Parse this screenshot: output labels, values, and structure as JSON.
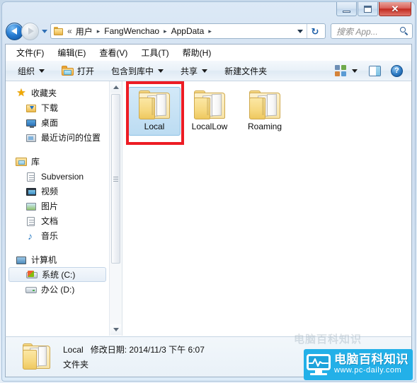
{
  "window": {
    "controls": {
      "minimize": "–",
      "maximize": "□",
      "close": "✕"
    }
  },
  "address": {
    "back_tooltip": "后退",
    "forward_tooltip": "前进",
    "chevron": "«",
    "crumbs": [
      "用户",
      "FangWenchao",
      "AppData"
    ],
    "separator": "▸",
    "refresh_glyph": "↻"
  },
  "search": {
    "placeholder": "搜索 App..."
  },
  "menu": {
    "items": [
      {
        "label": "文件(F)"
      },
      {
        "label": "编辑(E)"
      },
      {
        "label": "查看(V)"
      },
      {
        "label": "工具(T)"
      },
      {
        "label": "帮助(H)"
      }
    ]
  },
  "toolbar": {
    "organize": "组织",
    "open": "打开",
    "include_in_library": "包含到库中",
    "share": "共享",
    "new_folder": "新建文件夹",
    "help_glyph": "?"
  },
  "sidebar": {
    "groups": [
      {
        "header": {
          "label": "收藏夹",
          "icon": "star-icon"
        },
        "items": [
          {
            "label": "下载",
            "icon": "downloads-icon"
          },
          {
            "label": "桌面",
            "icon": "desktop-icon"
          },
          {
            "label": "最近访问的位置",
            "icon": "recent-places-icon"
          }
        ]
      },
      {
        "header": {
          "label": "库",
          "icon": "library-icon"
        },
        "items": [
          {
            "label": "Subversion",
            "icon": "subversion-icon"
          },
          {
            "label": "视频",
            "icon": "video-icon"
          },
          {
            "label": "图片",
            "icon": "pictures-icon"
          },
          {
            "label": "文档",
            "icon": "documents-icon"
          },
          {
            "label": "音乐",
            "icon": "music-icon"
          }
        ]
      },
      {
        "header": {
          "label": "计算机",
          "icon": "computer-icon"
        },
        "items": [
          {
            "label": "系统 (C:)",
            "icon": "system-drive-icon",
            "selected": true
          },
          {
            "label": "办公 (D:)",
            "icon": "drive-icon",
            "selected": false
          }
        ]
      }
    ]
  },
  "content": {
    "items": [
      {
        "name": "Local",
        "type": "folder",
        "selected": true
      },
      {
        "name": "LocalLow",
        "type": "folder",
        "selected": false
      },
      {
        "name": "Roaming",
        "type": "folder",
        "selected": false
      }
    ]
  },
  "status": {
    "name": "Local",
    "meta": "修改日期: 2014/11/3 下午 6:07",
    "type": "文件夹"
  },
  "watermark": {
    "title": "电脑百科知识",
    "url": "www.pc-daily.com",
    "accent": "#23b0e8"
  },
  "colors": {
    "annotation": "#ed1c24",
    "selection": "#bcdcf2",
    "titlebar": "#cfdef0"
  }
}
